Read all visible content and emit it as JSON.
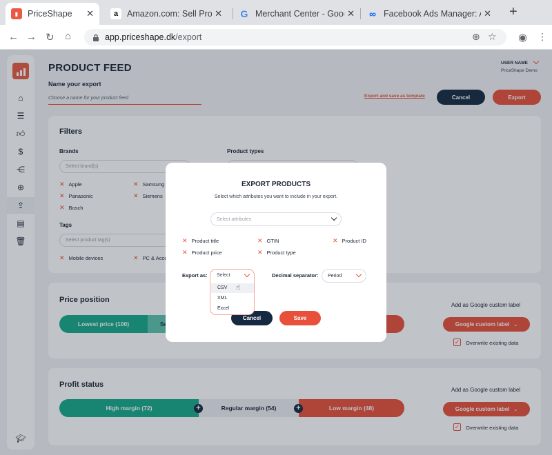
{
  "browser": {
    "tabs": [
      {
        "title": "PriceShape",
        "favicon": "priceshape-logo-icon",
        "active": true
      },
      {
        "title": "Amazon.com: Sell Products",
        "favicon": "amazon-icon",
        "active": false
      },
      {
        "title": "Merchant Center - Google f",
        "favicon": "google-icon",
        "active": false
      },
      {
        "title": "Facebook Ads Manager: Ad",
        "favicon": "meta-icon",
        "active": false
      }
    ],
    "url_host": "app.priceshape.dk",
    "url_path": "/export"
  },
  "page": {
    "title": "PRODUCT FEED",
    "name_label": "Name your export",
    "name_placeholder": "Choose a name for your product feed",
    "export_template_link": "Export and save as template",
    "cancel_label": "Cancel",
    "export_label": "Export",
    "user_name": "USER NAME",
    "user_company": "PriceShape Demo"
  },
  "filters": {
    "title": "Filters",
    "brands_label": "Brands",
    "brands_placeholder": "Select brand(s)",
    "brands": [
      "Apple",
      "Samsung",
      "Panasonic",
      "Siemens",
      "Bosch"
    ],
    "product_types_label": "Product types",
    "tags_label": "Tags",
    "tags_placeholder": "Select product tag(s)",
    "tags": [
      "Mobile devices",
      "PC & Acce"
    ]
  },
  "price_position": {
    "title": "Price position",
    "segments": [
      "Lowest price (100)",
      "Se"
    ],
    "custom_label_title": "Add as Google custom label",
    "custom_label_button": "Google custom label",
    "overwrite_label": "Overwrite existing data"
  },
  "profit_status": {
    "title": "Profit status",
    "segments": [
      "High margin (72)",
      "Regular margin (54)",
      "Low margin (48)"
    ],
    "custom_label_title": "Add as Google custom label",
    "custom_label_button": "Google custom label",
    "overwrite_label": "Overwrite existing data"
  },
  "modal": {
    "title": "EXPORT PRODUCTS",
    "subtitle": "Select which attributes you want to include in your export.",
    "attributes_placeholder": "Select attributes",
    "attributes": [
      "Product title",
      "GTIN",
      "Product ID",
      "Product price",
      "Product type"
    ],
    "export_as_label": "Export as:",
    "export_as_value": "Select",
    "export_options": [
      "CSV",
      "XML",
      "Excel"
    ],
    "decimal_label": "Decimal separator:",
    "decimal_value": "Period",
    "cancel_label": "Cancel",
    "save_label": "Save"
  },
  "colors": {
    "accent": "#e8503a",
    "navy": "#152a40",
    "green": "#17a98a"
  }
}
